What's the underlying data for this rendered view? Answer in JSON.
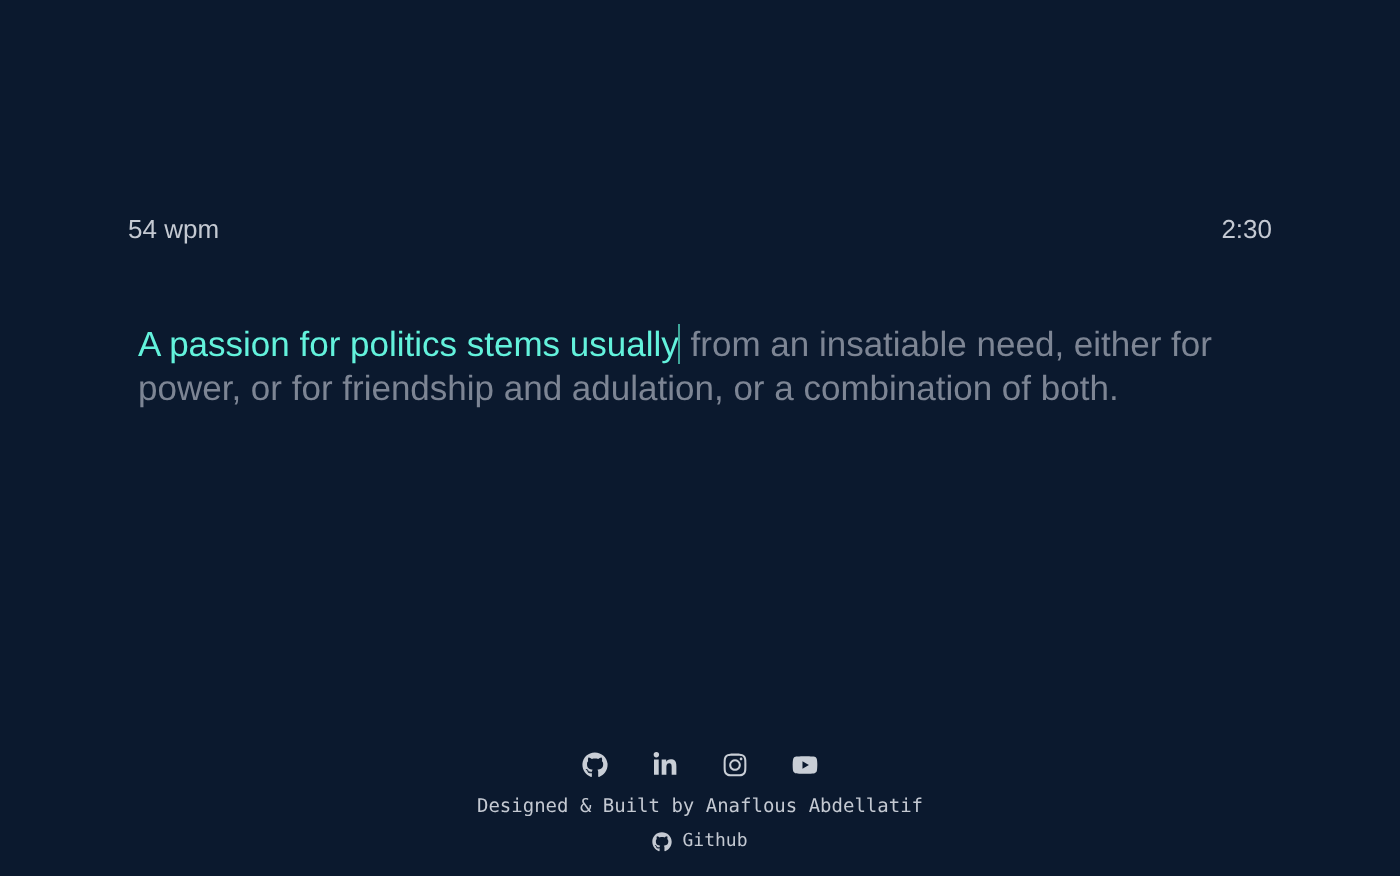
{
  "stats": {
    "wpm": "54 wpm",
    "timer": "2:30"
  },
  "passage": {
    "typed": "A passion for politics stems usually",
    "remaining": " from an insatiable need, either for power, or for friendship and adulation, or a combination of both."
  },
  "footer": {
    "socials": [
      {
        "kind": "github"
      },
      {
        "kind": "linkedin"
      },
      {
        "kind": "instagram"
      },
      {
        "kind": "youtube"
      }
    ],
    "credit": "Designed & Built by Anaflous Abdellatif",
    "repo_link": "Github"
  }
}
